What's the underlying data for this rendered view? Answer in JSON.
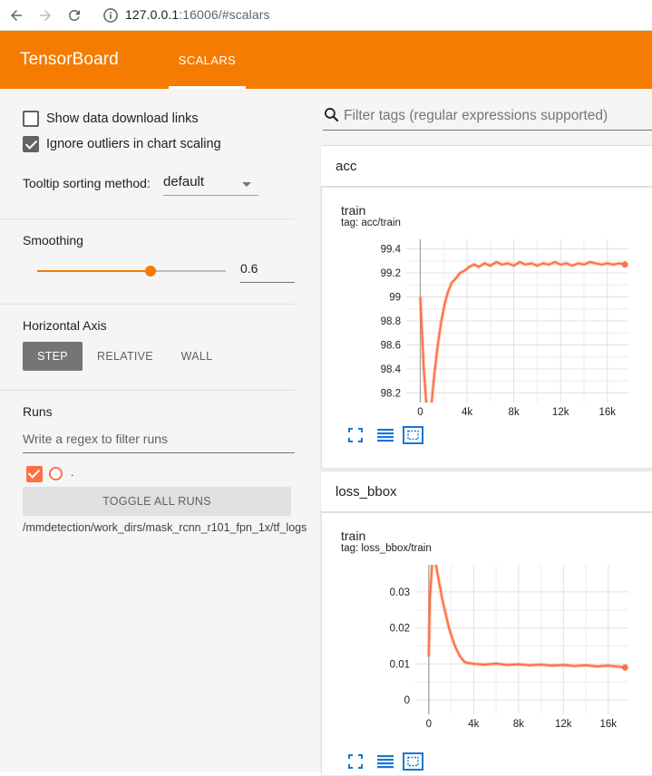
{
  "browser": {
    "url_host": "127.0.0.1",
    "url_rest": ":16006/#scalars"
  },
  "header": {
    "brand": "TensorBoard",
    "tab": "SCALARS",
    "colors": {
      "header": "#f57c00",
      "accent": "#f57c00",
      "run": "#ff7043"
    }
  },
  "sidebar": {
    "show_download_links": {
      "label": "Show data download links",
      "checked": false
    },
    "ignore_outliers": {
      "label": "Ignore outliers in chart scaling",
      "checked": true
    },
    "tooltip_sorting": {
      "label": "Tooltip sorting method:",
      "value": "default"
    },
    "smoothing": {
      "label": "Smoothing",
      "value": "0.6",
      "fraction": 0.6
    },
    "horizontal_axis": {
      "label": "Horizontal Axis",
      "options": [
        "STEP",
        "RELATIVE",
        "WALL"
      ],
      "selected": "STEP"
    },
    "runs": {
      "label": "Runs",
      "filter_placeholder": "Write a regex to filter runs",
      "items": [
        {
          "name": ".",
          "checked": true
        }
      ],
      "toggle_all": "TOGGLE ALL RUNS",
      "logdir": "/mmdetection/work_dirs/mask_rcnn_r101_fpn_1x/tf_logs"
    }
  },
  "main": {
    "filter_placeholder": "Filter tags (regular expressions supported)",
    "groups": [
      {
        "name": "acc",
        "card": {
          "title": "train",
          "tag": "tag: acc/train"
        }
      },
      {
        "name": "loss_bbox",
        "card": {
          "title": "train",
          "tag": "tag: loss_bbox/train"
        }
      }
    ],
    "toolbar_icons": [
      "fullscreen-icon",
      "list-icon",
      "fit-domain-icon"
    ]
  },
  "chart_data": [
    {
      "type": "line",
      "title": "train",
      "subtitle": "tag: acc/train",
      "xlim": [
        -1200,
        17800
      ],
      "ylim": [
        98.12,
        99.48
      ],
      "x_ticks": [
        0,
        4000,
        8000,
        12000,
        16000
      ],
      "x_tick_labels": [
        "0",
        "4k",
        "8k",
        "12k",
        "16k"
      ],
      "y_ticks": [
        98.2,
        98.4,
        98.6,
        98.8,
        99,
        99.2,
        99.4
      ],
      "y_tick_labels": [
        "98.2",
        "98.4",
        "98.6",
        "98.8",
        "99",
        "99.2",
        "99.4"
      ],
      "grid": true,
      "series": [
        {
          "x": [
            0,
            300,
            600,
            900,
            1200,
            1500,
            1800,
            2100,
            2400,
            2700,
            3000,
            3400,
            3800,
            4200,
            4600,
            5000,
            5500,
            6000,
            6500,
            7000,
            7500,
            8000,
            8500,
            9000,
            9500,
            10000,
            10500,
            11000,
            11500,
            12000,
            12500,
            13000,
            13500,
            14000,
            14500,
            15000,
            15500,
            16000,
            16500,
            17000,
            17500
          ],
          "y": [
            99.0,
            98.4,
            98.0,
            98.05,
            98.35,
            98.6,
            98.8,
            98.95,
            99.05,
            99.12,
            99.15,
            99.2,
            99.22,
            99.25,
            99.27,
            99.25,
            99.28,
            99.26,
            99.29,
            99.27,
            99.28,
            99.26,
            99.29,
            99.27,
            99.28,
            99.26,
            99.28,
            99.27,
            99.29,
            99.27,
            99.28,
            99.26,
            99.28,
            99.27,
            99.29,
            99.28,
            99.27,
            99.28,
            99.27,
            99.28,
            99.27
          ]
        }
      ]
    },
    {
      "type": "line",
      "title": "train",
      "subtitle": "tag: loss_bbox/train",
      "xlim": [
        -1200,
        17800
      ],
      "ylim": [
        -0.004,
        0.0375
      ],
      "x_ticks": [
        0,
        4000,
        8000,
        12000,
        16000
      ],
      "x_tick_labels": [
        "0",
        "4k",
        "8k",
        "12k",
        "16k"
      ],
      "y_ticks": [
        0,
        0.01,
        0.02,
        0.03
      ],
      "y_tick_labels": [
        "0",
        "0.01",
        "0.02",
        "0.03"
      ],
      "grid": true,
      "series": [
        {
          "x": [
            0,
            100,
            300,
            600,
            900,
            1200,
            1500,
            1800,
            2100,
            2400,
            2800,
            3200,
            3600,
            4000,
            5000,
            6000,
            7000,
            8000,
            9000,
            10000,
            11000,
            12000,
            13000,
            14000,
            15000,
            16000,
            17000,
            17500
          ],
          "y": [
            0.012,
            0.028,
            0.038,
            0.038,
            0.033,
            0.028,
            0.024,
            0.02,
            0.017,
            0.0145,
            0.012,
            0.0105,
            0.0102,
            0.01,
            0.0098,
            0.0101,
            0.0097,
            0.0099,
            0.0096,
            0.0098,
            0.0095,
            0.0097,
            0.0094,
            0.0096,
            0.0093,
            0.0095,
            0.0092,
            0.009
          ]
        }
      ]
    }
  ]
}
